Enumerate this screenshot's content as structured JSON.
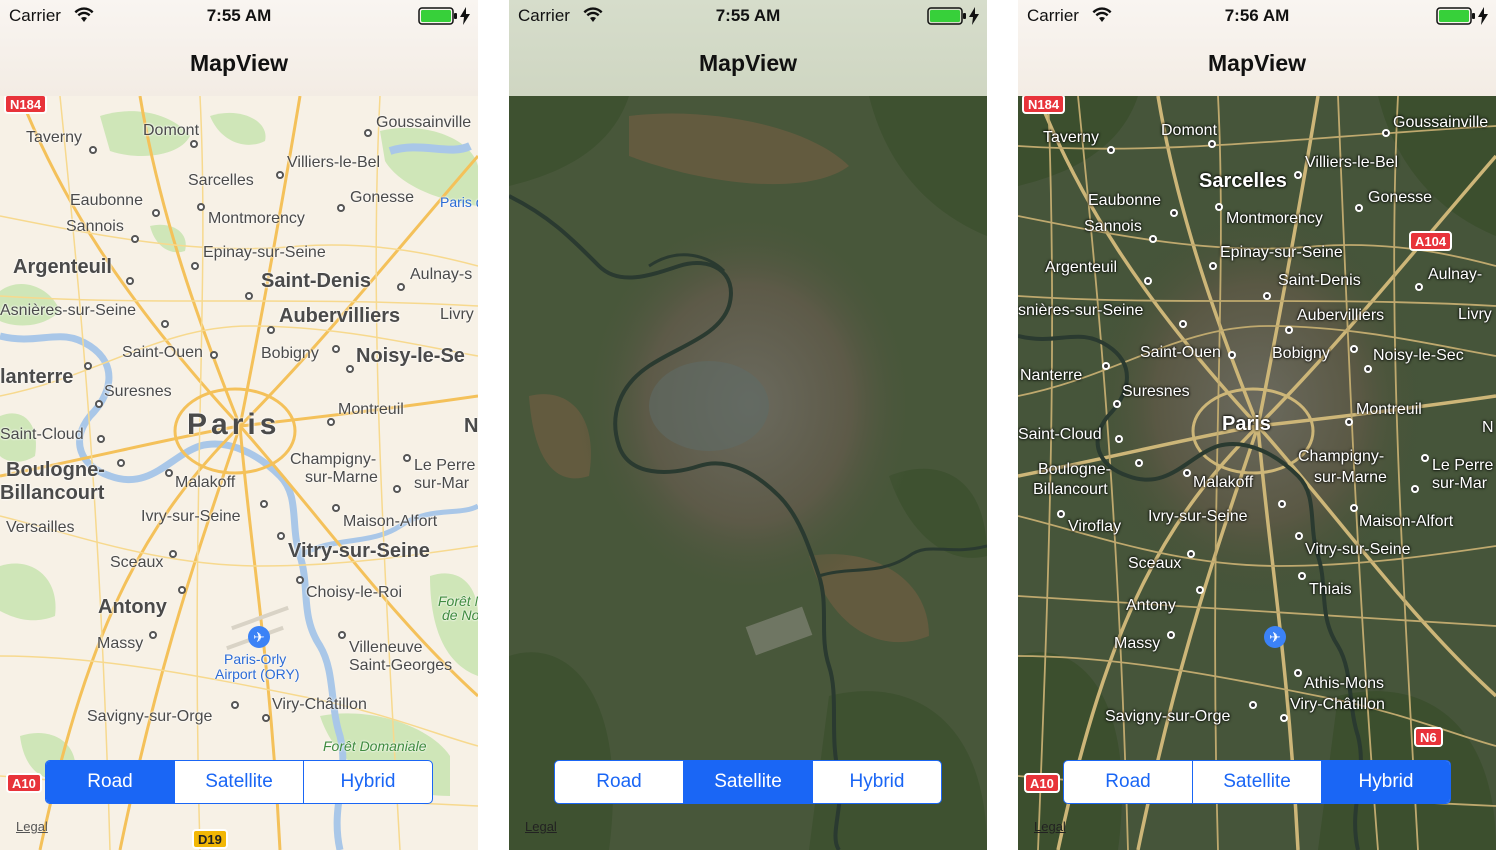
{
  "screens": [
    {
      "status": {
        "carrier": "Carrier",
        "time": "7:55 AM"
      },
      "nav_title": "MapView",
      "map_type": "Road",
      "legal": "Legal",
      "segments": [
        "Road",
        "Satellite",
        "Hybrid"
      ],
      "selected_segment": "Road",
      "shields": [
        "N184",
        "A10",
        "D19"
      ],
      "places": {
        "taverny": "Taverny",
        "domont": "Domont",
        "goussainville": "Goussainville",
        "villiers": "Villiers-le-Bel",
        "sarcelles": "Sarcelles",
        "eaubonne": "Eaubonne",
        "gonesse": "Gonesse",
        "montmorency": "Montmorency",
        "sannois": "Sannois",
        "paris_cdg": "Paris de G Airpo",
        "epinay": "Epinay-sur-Seine",
        "argenteuil": "Argenteuil",
        "saint_denis": "Saint-Denis",
        "aulnay": "Aulnay-s",
        "asnieres": "Asnières-sur-Seine",
        "aubervilliers": "Aubervilliers",
        "livry": "Livry",
        "saint_ouen": "Saint-Ouen",
        "bobigny": "Bobigny",
        "noisy": "Noisy-le-Se",
        "nanterre": "lanterre",
        "suresnes": "Suresnes",
        "montreuil": "Montreuil",
        "paris": "Paris",
        "saint_cloud": "Saint-Cloud",
        "n": "N",
        "boulogne": "Boulogne-",
        "billancourt": "Billancourt",
        "champigny": "Champigny-",
        "sur_marne": "sur-Marne",
        "le_perre": "Le Perre",
        "sur_mar": "sur-Mar",
        "malakoff": "Malakoff",
        "versailles": "Versailles",
        "ivry": "Ivry-sur-Seine",
        "maison_alfort": "Maison-Alfort",
        "vitry": "Vitry-sur-Seine",
        "sceaux": "Sceaux",
        "choisy": "Choisy-le-Roi",
        "antony": "Antony",
        "foret_n": "Forêt N",
        "de_no": "de No",
        "massy": "Massy",
        "villeneuve": "Villeneuve",
        "st_georges": "Saint-Georges",
        "orly1": "Paris-Orly",
        "orly2": "Airport (ORY)",
        "savigny": "Savigny-sur-Orge",
        "viry": "Viry-Châtillon",
        "foret_dom": "Forêt Domaniale"
      }
    },
    {
      "status": {
        "carrier": "Carrier",
        "time": "7:55 AM"
      },
      "nav_title": "MapView",
      "map_type": "Satellite",
      "legal": "Legal",
      "segments": [
        "Road",
        "Satellite",
        "Hybrid"
      ],
      "selected_segment": "Satellite"
    },
    {
      "status": {
        "carrier": "Carrier",
        "time": "7:56 AM"
      },
      "nav_title": "MapView",
      "map_type": "Hybrid",
      "legal": "Legal",
      "segments": [
        "Road",
        "Satellite",
        "Hybrid"
      ],
      "selected_segment": "Hybrid",
      "shields": [
        "N184",
        "A104",
        "N6",
        "A10"
      ],
      "places": {
        "taverny": "Taverny",
        "domont": "Domont",
        "goussainville": "Goussainville",
        "villiers": "Villiers-le-Bel",
        "sarcelles": "Sarcelles",
        "eaubonne": "Eaubonne",
        "gonesse": "Gonesse",
        "montmorency": "Montmorency",
        "sannois": "Sannois",
        "epinay": "Epinay-sur-Seine",
        "argenteuil": "Argenteuil",
        "aulnay": "Aulnay-",
        "saint_denis": "Saint-Denis",
        "asnieres": "snières-sur-Seine",
        "livry": "Livry",
        "aubervilliers": "Aubervilliers",
        "saint_ouen": "Saint-Ouen",
        "bobigny": "Bobigny",
        "noisy": "Noisy-le-Sec",
        "nanterre": "Nanterre",
        "suresnes": "Suresnes",
        "montreuil": "Montreuil",
        "paris": "Paris",
        "saint_cloud": "Saint-Cloud",
        "n": "N",
        "boulogne": "Boulogne-",
        "billancourt": "Billancourt",
        "champigny": "Champigny-",
        "sur_marne": "sur-Marne",
        "le_perre": "Le Perre",
        "sur_mar": "sur-Mar",
        "malakoff": "Malakoff",
        "viroflay": "Viroflay",
        "ivry": "Ivry-sur-Seine",
        "maison_alfort": "Maison-Alfort",
        "vitry": "Vitry-sur-Seine",
        "sceaux": "Sceaux",
        "thiais": "Thiais",
        "antony": "Antony",
        "massy": "Massy",
        "athis": "Athis-Mons",
        "savigny": "Savigny-sur-Orge",
        "viry": "Viry-Châtillon"
      }
    }
  ]
}
